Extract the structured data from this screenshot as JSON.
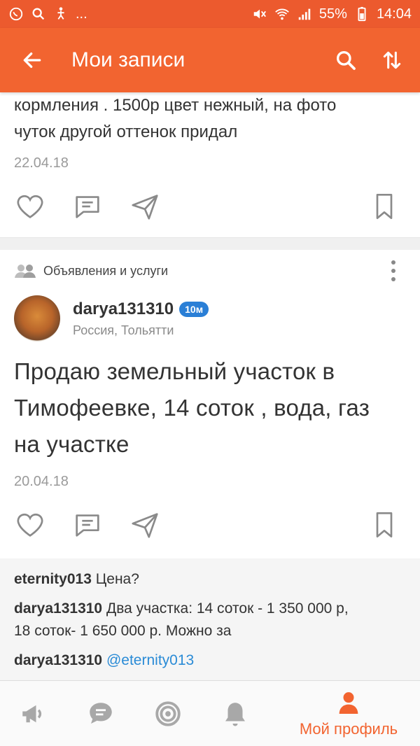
{
  "status_bar": {
    "battery": "55%",
    "time": "14:04",
    "more": "..."
  },
  "app_bar": {
    "title": "Мои записи",
    "back_icon": "arrow-left-icon",
    "search_icon": "search-icon",
    "sort_icon": "sort-arrows-icon"
  },
  "post1": {
    "text_lines": [
      "кормления . 1500р цвет нежный, на фото",
      "чуток другой оттенок придал"
    ],
    "date": "22.04.18"
  },
  "post2": {
    "group": "Объявления и услуги",
    "author": {
      "name": "darya131310",
      "badge": "10м",
      "location": "Россия, Тольятти"
    },
    "text_lines": [
      "Продаю земельный участок в",
      "Тимофеевке, 14 соток , вода, газ",
      "на участке"
    ],
    "date": "20.04.18"
  },
  "comments": [
    {
      "author": "eternity013",
      "text": "Цена?"
    },
    {
      "author": "darya131310",
      "text": "Два участка: 14 соток - 1 350 000 р,",
      "text2": "18 соток- 1 650 000 р. Можно за"
    },
    {
      "author": "darya131310",
      "mention": "@eternity013"
    }
  ],
  "bottom_nav": {
    "items": [
      "megaphone-icon",
      "chat-icon",
      "target-icon",
      "bell-icon",
      "profile-icon"
    ],
    "profile_label": "Мой профиль"
  },
  "colors": {
    "accent": "#f26430",
    "status_bar": "#ec5a2e",
    "badge": "#2a7fd6",
    "link": "#2a8bd6"
  }
}
